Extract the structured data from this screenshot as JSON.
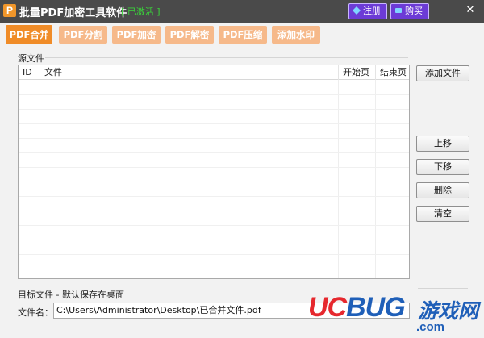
{
  "window": {
    "app_icon": "P",
    "title": "批量PDF加密工具软件",
    "status": "[ 已激活 ]",
    "register_label": "注册",
    "buy_label": "购买",
    "minimize": "—",
    "close": "✕"
  },
  "tabs": [
    {
      "label": "PDF合并"
    },
    {
      "label": "PDF分割"
    },
    {
      "label": "PDF加密"
    },
    {
      "label": "PDF解密"
    },
    {
      "label": "PDF压缩"
    },
    {
      "label": "添加水印"
    }
  ],
  "source": {
    "group_label": "源文件",
    "columns": [
      "ID",
      "文件",
      "开始页",
      "结束页"
    ],
    "rows": []
  },
  "side_buttons": {
    "add": "添加文件",
    "up": "上移",
    "down": "下移",
    "delete": "删除",
    "clear": "清空"
  },
  "target": {
    "group_label": "目标文件 - 默认保存在桌面",
    "filename_label": "文件名：",
    "filename_value": "C:\\Users\\Administrator\\Desktop\\已合并文件.pdf"
  },
  "watermark": {
    "uc": "UC",
    "bug": "BUG",
    "game": "游戏网",
    "domain": ".com"
  },
  "colors": {
    "title_bar": "#4a4a4a",
    "accent_orange": "#f08c28",
    "tab_inactive": "#f6b98a",
    "purple_button": "#6c3bd6",
    "activated_green": "#3ad43a"
  },
  "icons": {
    "register": "diamond-icon",
    "buy": "cart-icon"
  }
}
